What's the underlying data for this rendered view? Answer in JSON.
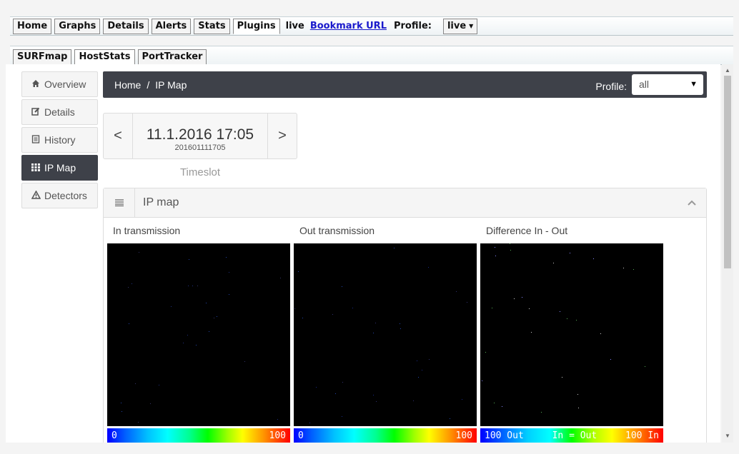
{
  "nav": {
    "tabs": [
      {
        "label": "Home"
      },
      {
        "label": "Graphs"
      },
      {
        "label": "Details"
      },
      {
        "label": "Alerts"
      },
      {
        "label": "Stats"
      },
      {
        "label": "Plugins"
      }
    ],
    "live_text": "live",
    "bookmark_label": "Bookmark URL",
    "profile_label": "Profile:",
    "profile_value": "live"
  },
  "plugin_tabs": [
    {
      "label": "SURFmap"
    },
    {
      "label": "HostStats"
    },
    {
      "label": "PortTracker"
    }
  ],
  "sidebar": {
    "items": [
      {
        "label": "Overview",
        "icon": "home-icon"
      },
      {
        "label": "Details",
        "icon": "edit-icon"
      },
      {
        "label": "History",
        "icon": "list-icon"
      },
      {
        "label": "IP Map",
        "icon": "grid-icon"
      },
      {
        "label": "Detectors",
        "icon": "warning-icon"
      }
    ]
  },
  "breadcrumb": {
    "home": "Home",
    "separator": "/",
    "current": "IP Map",
    "profile_label": "Profile:",
    "profile_value": "all"
  },
  "timeslot": {
    "prev": "<",
    "next": ">",
    "date": "11.1.2016 17:05",
    "code": "201601111705",
    "label": "Timeslot"
  },
  "panel": {
    "title": "IP map",
    "maps": [
      {
        "label": "In transmission",
        "scale_left": "0",
        "scale_right": "100"
      },
      {
        "label": "Out transmission",
        "scale_left": "0",
        "scale_right": "100"
      },
      {
        "label": "Difference In - Out",
        "scale_left": "100 Out",
        "scale_mid": "In = Out",
        "scale_right": "100 In"
      }
    ]
  }
}
